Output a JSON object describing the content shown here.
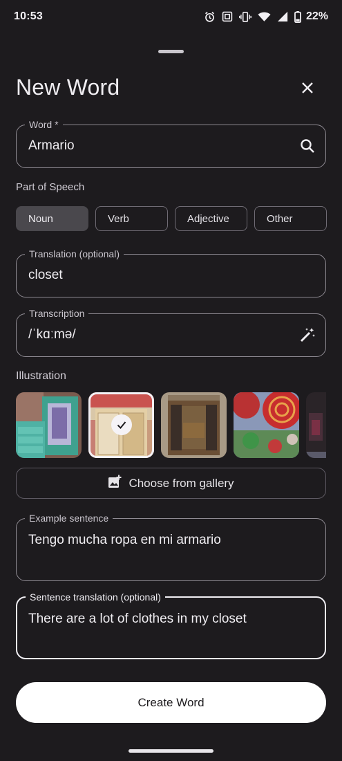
{
  "status_bar": {
    "time": "10:53",
    "battery": "22%",
    "icons": [
      "alarm-icon",
      "nfc-icon",
      "vibrate-icon",
      "wifi-icon",
      "signal-icon",
      "battery-icon"
    ]
  },
  "sheet": {
    "title": "New Word",
    "close_icon": "close-icon"
  },
  "word_field": {
    "label": "Word *",
    "value": "Armario",
    "icon": "search-icon"
  },
  "part_of_speech": {
    "label": "Part of Speech",
    "options": [
      "Noun",
      "Verb",
      "Adjective",
      "Other"
    ],
    "selected": "Noun"
  },
  "translation_field": {
    "label": "Translation (optional)",
    "value": "closet"
  },
  "transcription_field": {
    "label": "Transcription",
    "value": "/ˈkɑːmə/",
    "icon": "magic-wand-icon"
  },
  "illustration": {
    "label": "Illustration",
    "thumbnails": [
      {
        "name": "turquoise-cabinet",
        "selected": false
      },
      {
        "name": "patchwork-cupboard",
        "selected": true
      },
      {
        "name": "ornate-wooden-wardrobe",
        "selected": false
      },
      {
        "name": "red-mosaic",
        "selected": false
      },
      {
        "name": "dark-room",
        "selected": false
      }
    ],
    "gallery_button": "Choose from gallery",
    "gallery_icon": "add-photo-icon"
  },
  "example_field": {
    "label": "Example sentence",
    "value": "Tengo mucha ropa en mi armario"
  },
  "sentence_translation_field": {
    "label": "Sentence translation (optional)",
    "value": "There are a lot of clothes in my closet"
  },
  "actions": {
    "create": "Create Word"
  },
  "colors": {
    "background": "#1d1b1e",
    "chip_selected": "#4a484d",
    "primary_button": "#ffffff"
  }
}
